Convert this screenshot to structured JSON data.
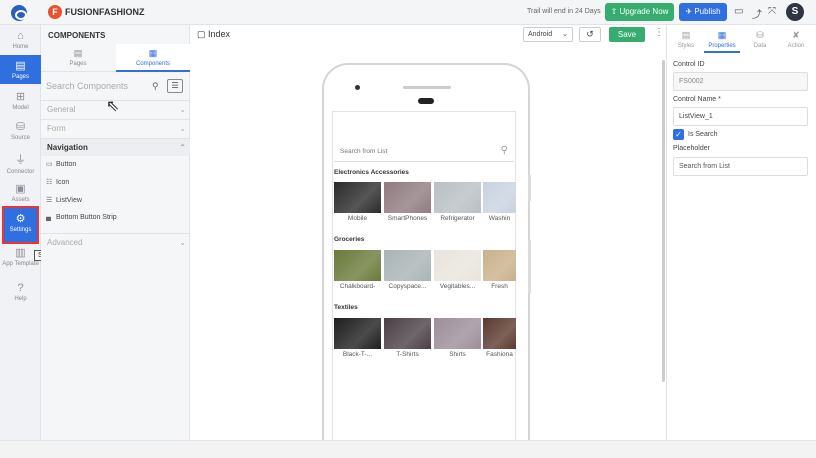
{
  "topbar": {
    "brand": "FUSIONFASHIONZ",
    "brand_initial": "F",
    "trial_text": "Trail will end in 24 Days",
    "upgrade_label": "⇧ Upgrade Now",
    "publish_label": "✈ Publish",
    "avatar_initial": "S"
  },
  "leftrail": {
    "items": [
      {
        "label": "Home",
        "icon": "home-icon",
        "glyph": "⌂"
      },
      {
        "label": "Pages",
        "icon": "page-icon",
        "glyph": "▤"
      },
      {
        "label": "Model",
        "icon": "model-icon",
        "glyph": "⊞"
      },
      {
        "label": "Source",
        "icon": "database-icon",
        "glyph": "⛁"
      },
      {
        "label": "Connector",
        "icon": "plug-icon",
        "glyph": "⏚"
      },
      {
        "label": "Assets",
        "icon": "assets-icon",
        "glyph": "▣"
      },
      {
        "label": "Settings",
        "icon": "gear-icon",
        "glyph": "⚙"
      },
      {
        "label": "App Template",
        "icon": "template-icon",
        "glyph": "▥"
      },
      {
        "label": "Help",
        "icon": "help-icon",
        "glyph": "?"
      }
    ],
    "tooltip": "Settings"
  },
  "components": {
    "title": "COMPONENTS",
    "tabs": [
      {
        "label": "Pages"
      },
      {
        "label": "Components"
      }
    ],
    "search_placeholder": "Search Components",
    "sections": [
      {
        "label": "General"
      },
      {
        "label": "Form"
      },
      {
        "label": "Navigation"
      },
      {
        "label": "Advanced"
      }
    ],
    "nav_items": [
      {
        "label": "Button",
        "glyph": "▭"
      },
      {
        "label": "Icon",
        "glyph": "☷"
      },
      {
        "label": "ListView",
        "glyph": "☰"
      },
      {
        "label": "Bottom Button Strip",
        "glyph": "▄"
      }
    ]
  },
  "canvas": {
    "title": "Index",
    "device": "Android",
    "save_label": "Save",
    "list_search_placeholder": "Search from List",
    "categories": [
      {
        "name": "Electronics Accessories",
        "items": [
          {
            "label": "Mobile",
            "color": "#2b2b2b"
          },
          {
            "label": "SmartPhones",
            "color": "#8f7b80"
          },
          {
            "label": "Refrigerator",
            "color": "#b9bfc4"
          },
          {
            "label": "Washin",
            "color": "#c8d3e0"
          }
        ]
      },
      {
        "name": "Groceries",
        "items": [
          {
            "label": "Chalkboard-",
            "color": "#6a7a3a"
          },
          {
            "label": "Copyspace...",
            "color": "#a9b3b5"
          },
          {
            "label": "Vegitables...",
            "color": "#e9e4dd"
          },
          {
            "label": "Fresh",
            "color": "#c9b08a"
          }
        ]
      },
      {
        "name": "Textiles",
        "items": [
          {
            "label": "Black-T-...",
            "color": "#1e1e1e"
          },
          {
            "label": "T-Shirts",
            "color": "#4a3f45"
          },
          {
            "label": "Shirts",
            "color": "#9c8e9a"
          },
          {
            "label": "Fashiona",
            "color": "#5b3a2e"
          }
        ]
      }
    ]
  },
  "properties": {
    "tabs": [
      {
        "label": "Styles",
        "glyph": "▤"
      },
      {
        "label": "Properties",
        "glyph": "▦"
      },
      {
        "label": "Data",
        "glyph": "⛁"
      },
      {
        "label": "Action",
        "glyph": "✘"
      }
    ],
    "control_id_label": "Control ID",
    "control_id_value": "FS0002",
    "control_name_label": "Control Name *",
    "control_name_value": "ListView_1",
    "is_search_label": "Is Search",
    "placeholder_label": "Placeholder",
    "placeholder_value": "Search from List"
  }
}
